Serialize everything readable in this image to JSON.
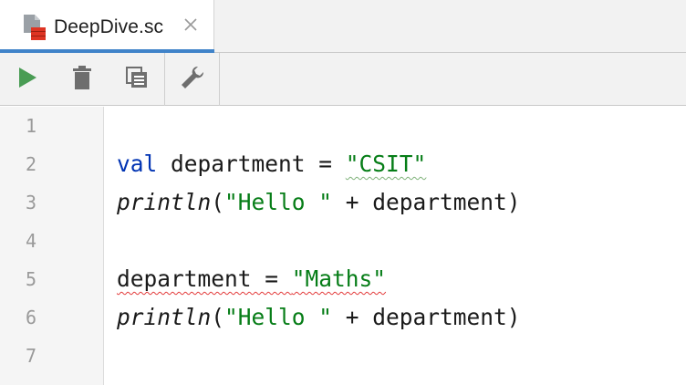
{
  "tab": {
    "title": "DeepDive.sc",
    "icon": "scala-file-icon"
  },
  "toolbar": {
    "buttons": [
      "run-icon",
      "trash-icon",
      "copy-icon",
      "wrench-icon"
    ],
    "accent_run": "#499c54"
  },
  "editor": {
    "line_numbers": [
      "1",
      "2",
      "3",
      "4",
      "5",
      "6",
      "7"
    ],
    "lines": {
      "l2": {
        "kw": "val",
        "rest": " department = ",
        "str": "\"CSIT\""
      },
      "l3": {
        "fn": "println",
        "rest": "(",
        "str": "\"Hello \"",
        "tail": " + department)"
      },
      "l5": {
        "err": "department = ",
        "str": "\"Maths\""
      },
      "l6": {
        "fn": "println",
        "rest": "(",
        "str": "\"Hello \"",
        "tail": " + department)"
      }
    }
  },
  "colors": {
    "keyword": "#0033b3",
    "string": "#067d17",
    "error_underline": "#e33b3b",
    "warning_underline": "#7fb27a",
    "tab_accent": "#4083c9"
  }
}
